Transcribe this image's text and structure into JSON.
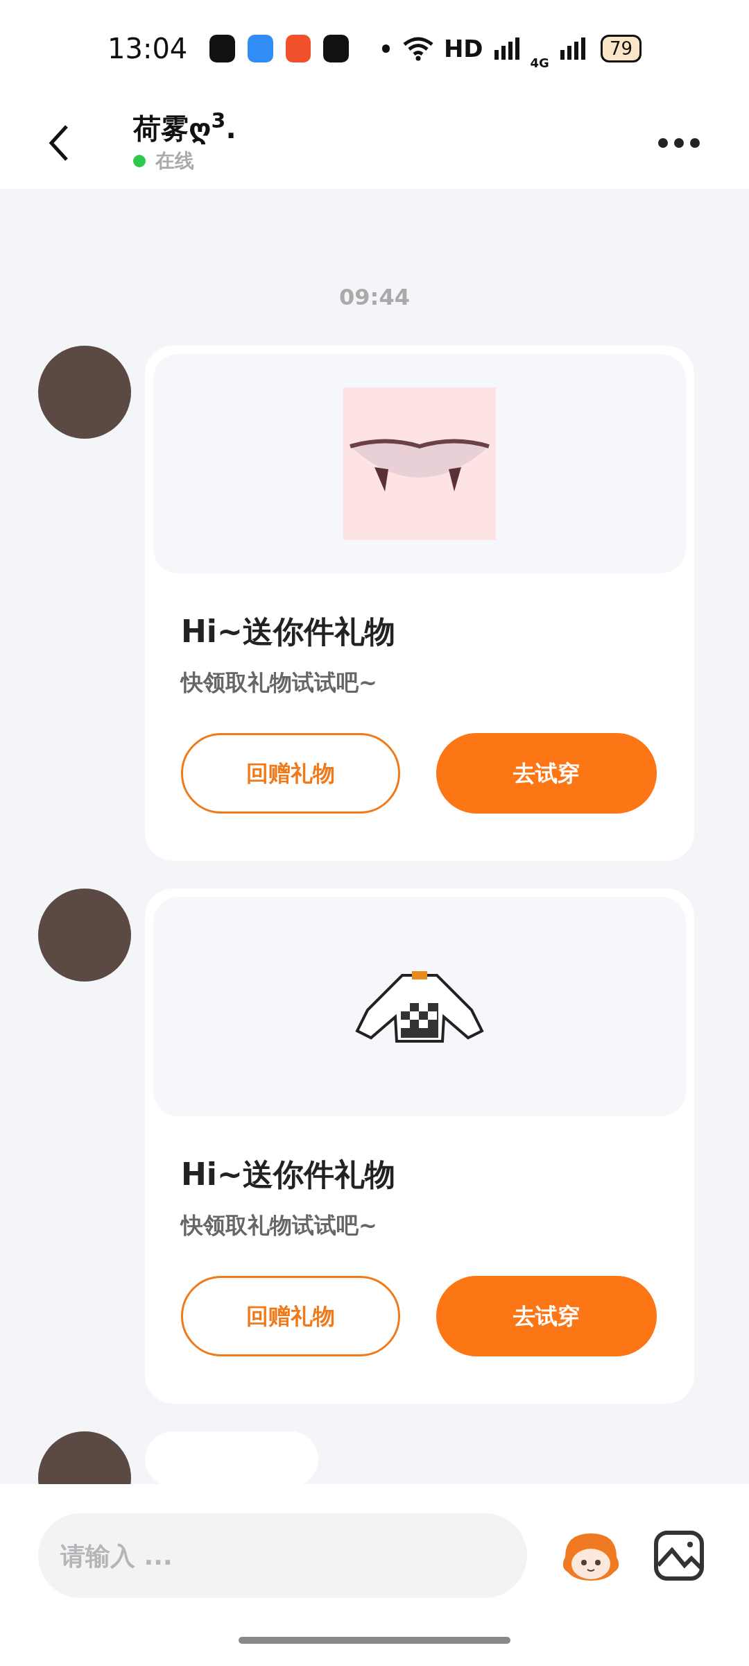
{
  "status_bar": {
    "time": "13:04",
    "network": "HD",
    "cellular": "4G",
    "battery": "79"
  },
  "header": {
    "title": "荷雾ღ$^{3}$.",
    "status": "在线",
    "online": true
  },
  "chat": {
    "timestamp": "09:44",
    "messages": [
      {
        "kind": "fangs",
        "title": "Hi~送你件礼物",
        "subtitle": "快领取礼物试试吧~",
        "buttons": [
          "回赠礼物",
          "去试穿"
        ]
      },
      {
        "kind": "jacket",
        "title": "Hi~送你件礼物",
        "subtitle": "快领取礼物试试吧~",
        "buttons": [
          "回赠礼物",
          "去试穿"
        ]
      }
    ]
  },
  "composer": {
    "placeholder": "请输入 ..."
  }
}
